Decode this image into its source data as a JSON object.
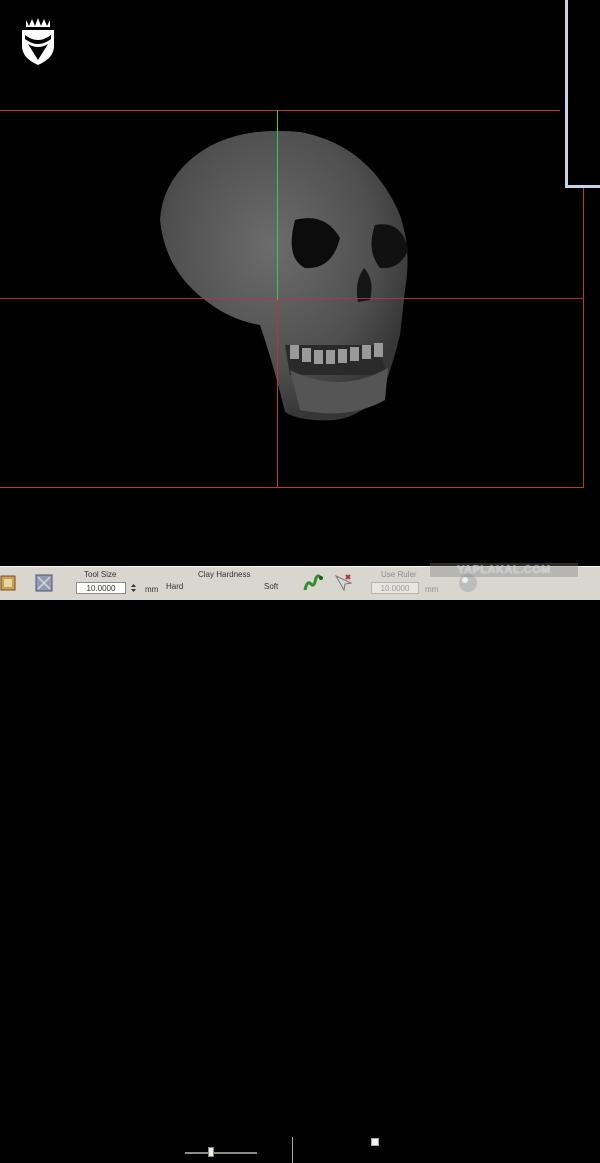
{
  "watermark": "YAPLAKAL.COM",
  "toolbar": {
    "tool_size": {
      "label": "Tool Size",
      "value": "10.0000",
      "unit": "mm"
    },
    "clay_hardness": {
      "label": "Clay Hardness",
      "min_label": "Hard",
      "max_label": "Soft",
      "level": 0.35
    },
    "ruler": {
      "checkbox_label": "Use Ruler",
      "value": "10.0000",
      "unit": "mm",
      "checked": false
    }
  },
  "colors": {
    "guide_line": "#b8314d",
    "active_axis": "#1fd84a",
    "panel_frame": "#c7d4e6",
    "toolbar_bg": "#d8d6cf"
  },
  "icons": [
    "university-crest-icon",
    "tool-icon-1",
    "tool-icon-2",
    "worm-tool-icon",
    "arrow-cursor-tool-icon",
    "sphere-tool-icon"
  ]
}
